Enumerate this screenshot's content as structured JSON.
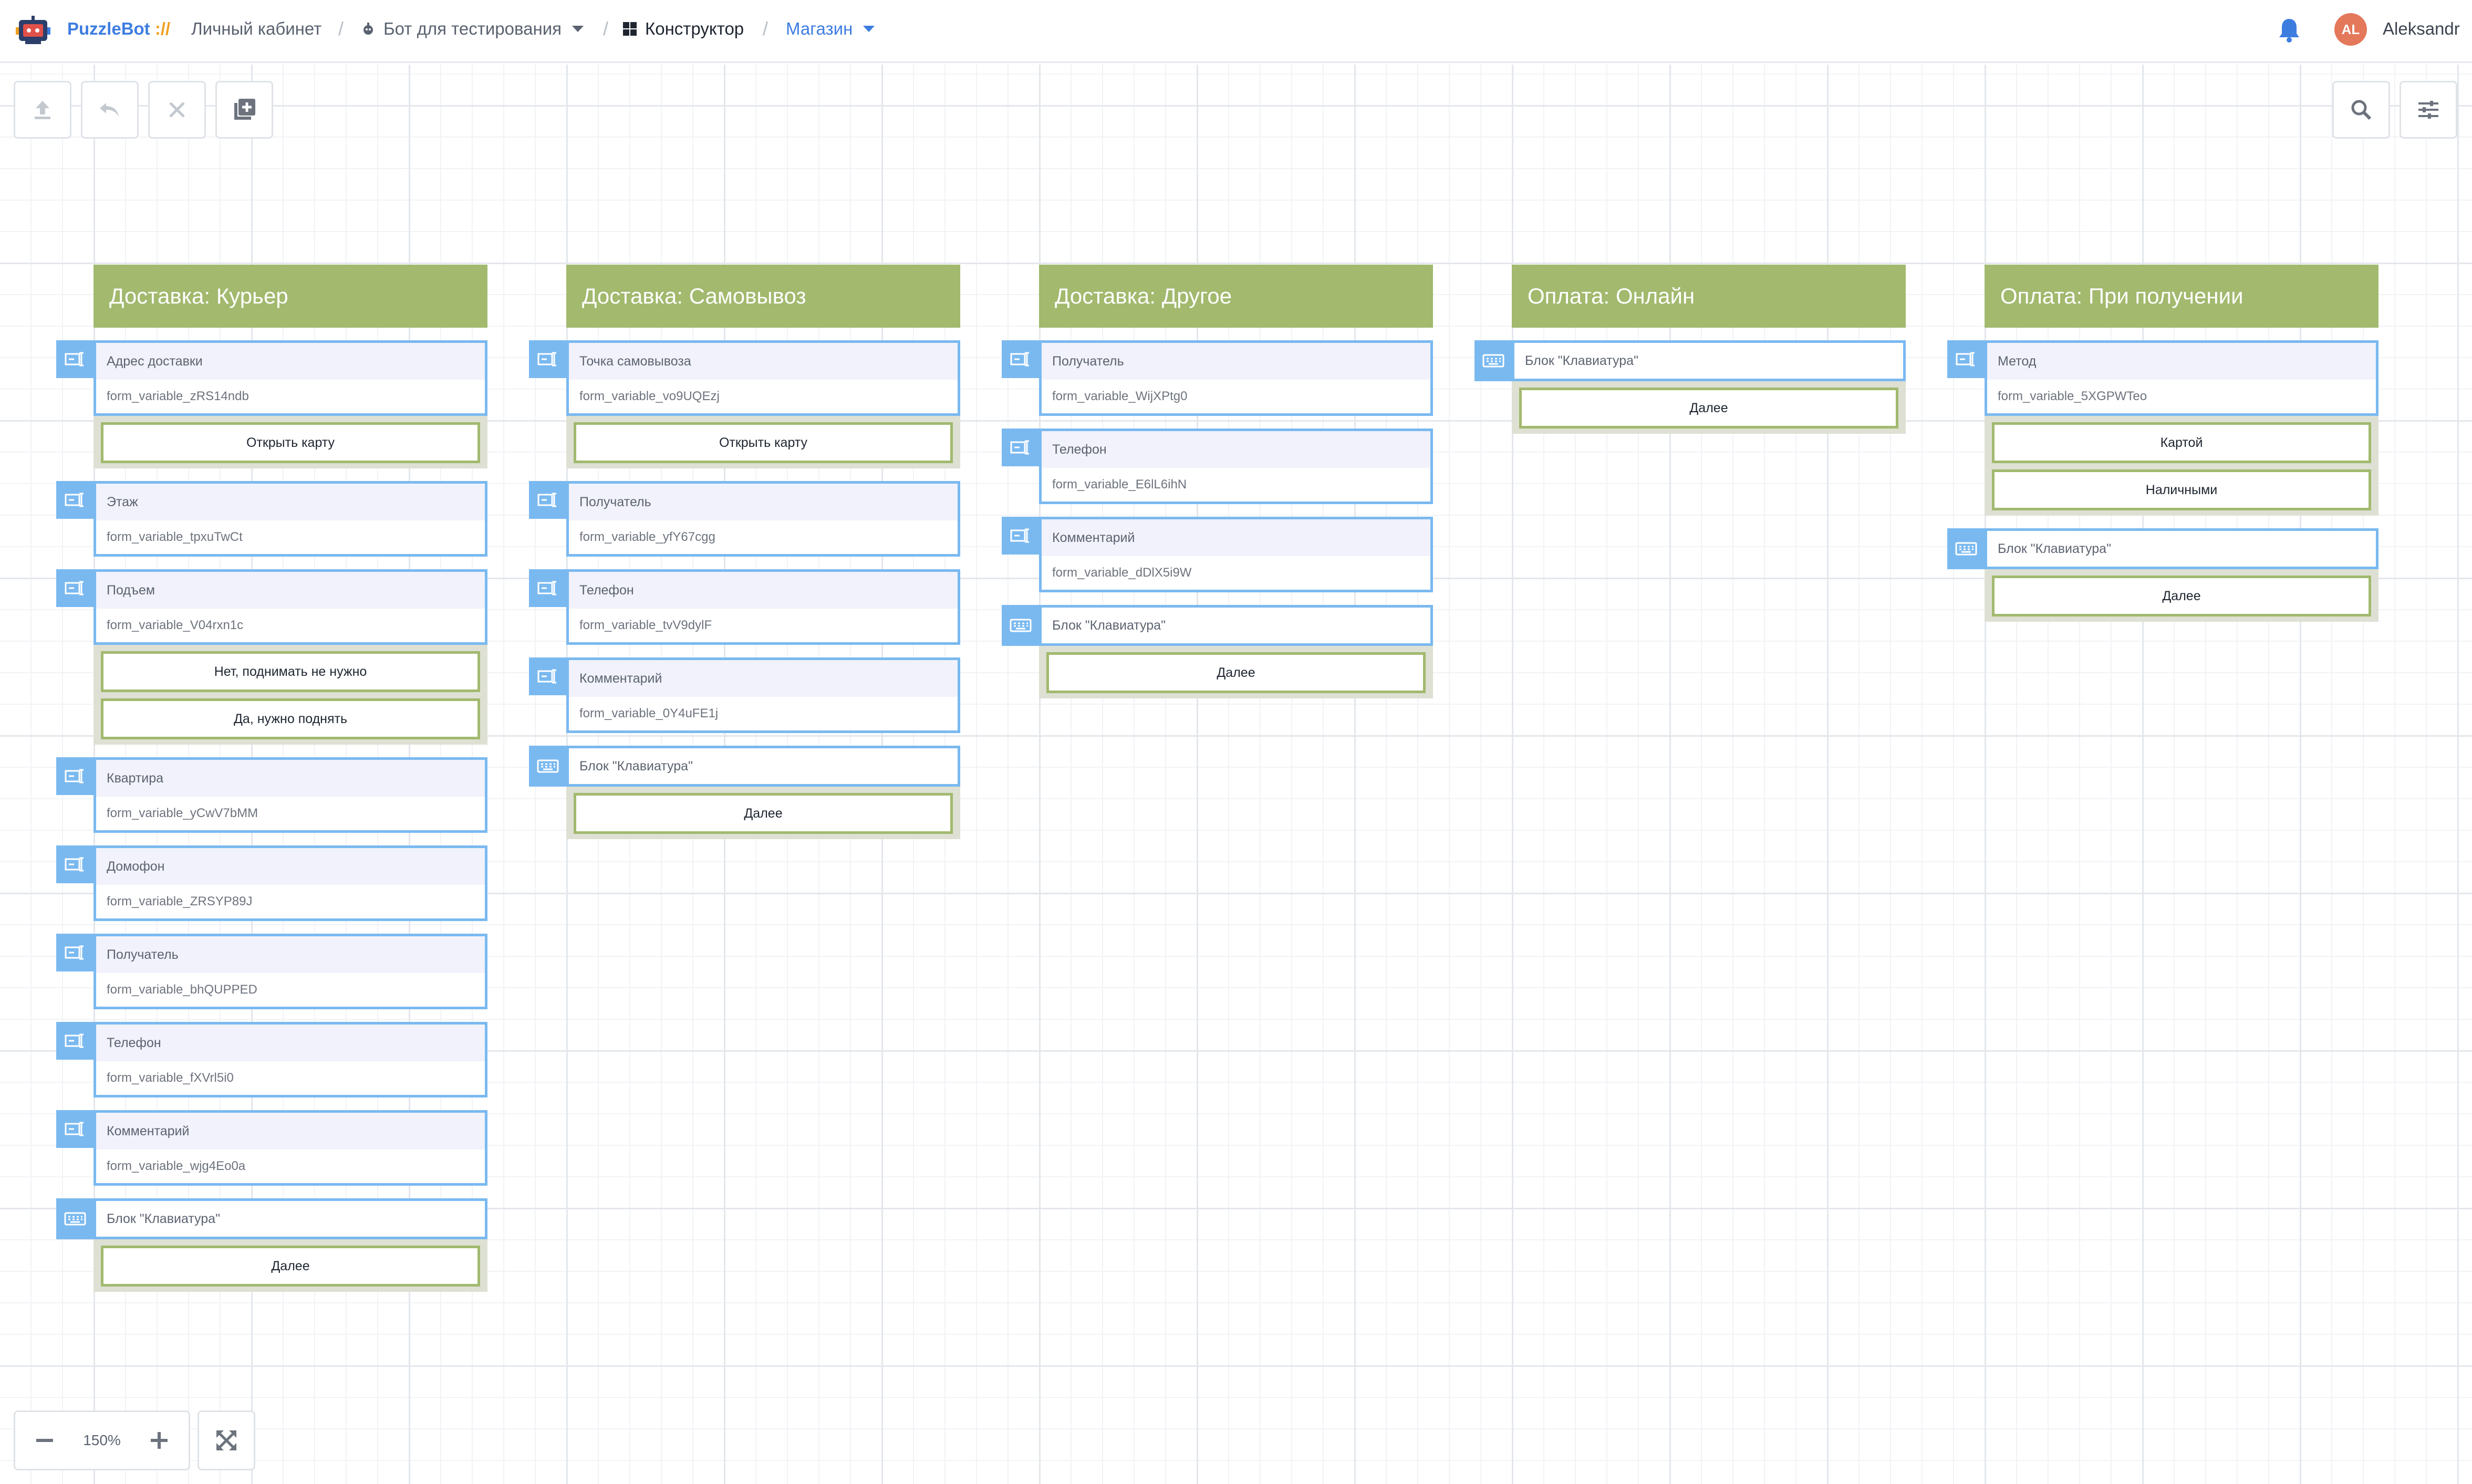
{
  "navbar": {
    "brand": "PuzzleBot",
    "brand_sep": "://",
    "breadcrumbs": [
      {
        "label": "Личный кабинет"
      },
      {
        "label": "Бот для тестирования"
      },
      {
        "label": "Конструктор"
      },
      {
        "label": "Магазин"
      }
    ],
    "user": {
      "initials": "AL",
      "name": "Aleksandr"
    }
  },
  "toolbar": {
    "left": [
      "upload-icon",
      "undo-icon",
      "close-icon",
      "add-block-icon"
    ],
    "right": [
      "search-icon",
      "settings-sliders-icon"
    ]
  },
  "colors": {
    "header_green": "#a2b96e",
    "block_blue": "#7ab9f0",
    "brand_blue": "#3d7de0",
    "avatar": "#e4785a"
  },
  "columns": [
    {
      "title": "Доставка: Курьер",
      "blocks": [
        {
          "type": "field",
          "label": "Адрес доставки",
          "variable": "form_variable_zRS14ndb",
          "buttons": [
            "Открыть карту"
          ]
        },
        {
          "type": "field",
          "label": "Этаж",
          "variable": "form_variable_tpxuTwCt",
          "buttons": []
        },
        {
          "type": "field",
          "label": "Подъем",
          "variable": "form_variable_V04rxn1c",
          "buttons": [
            "Нет, поднимать не нужно",
            "Да, нужно поднять"
          ]
        },
        {
          "type": "field",
          "label": "Квартира",
          "variable": "form_variable_yCwV7bMM",
          "buttons": []
        },
        {
          "type": "field",
          "label": "Домофон",
          "variable": "form_variable_ZRSYP89J",
          "buttons": []
        },
        {
          "type": "field",
          "label": "Получатель",
          "variable": "form_variable_bhQUPPED",
          "buttons": []
        },
        {
          "type": "field",
          "label": "Телефон",
          "variable": "form_variable_fXVrl5i0",
          "buttons": []
        },
        {
          "type": "field",
          "label": "Комментарий",
          "variable": "form_variable_wjg4Eo0a",
          "buttons": []
        },
        {
          "type": "keyboard",
          "label": "Блок \"Клавиатура\"",
          "buttons": [
            "Далее"
          ]
        }
      ]
    },
    {
      "title": "Доставка: Самовывоз",
      "blocks": [
        {
          "type": "field",
          "label": "Точка самовывоза",
          "variable": "form_variable_vo9UQEzj",
          "buttons": [
            "Открыть карту"
          ]
        },
        {
          "type": "field",
          "label": "Получатель",
          "variable": "form_variable_yfY67cgg",
          "buttons": []
        },
        {
          "type": "field",
          "label": "Телефон",
          "variable": "form_variable_tvV9dylF",
          "buttons": []
        },
        {
          "type": "field",
          "label": "Комментарий",
          "variable": "form_variable_0Y4uFE1j",
          "buttons": []
        },
        {
          "type": "keyboard",
          "label": "Блок \"Клавиатура\"",
          "buttons": [
            "Далее"
          ]
        }
      ]
    },
    {
      "title": "Доставка: Другое",
      "blocks": [
        {
          "type": "field",
          "label": "Получатель",
          "variable": "form_variable_WijXPtg0",
          "buttons": []
        },
        {
          "type": "field",
          "label": "Телефон",
          "variable": "form_variable_E6lL6ihN",
          "buttons": []
        },
        {
          "type": "field",
          "label": "Комментарий",
          "variable": "form_variable_dDlX5i9W",
          "buttons": []
        },
        {
          "type": "keyboard",
          "label": "Блок \"Клавиатура\"",
          "buttons": [
            "Далее"
          ]
        }
      ]
    },
    {
      "title": "Оплата: Онлайн",
      "blocks": [
        {
          "type": "keyboard",
          "label": "Блок \"Клавиатура\"",
          "buttons": [
            "Далее"
          ]
        }
      ]
    },
    {
      "title": "Оплата: При получении",
      "blocks": [
        {
          "type": "field",
          "label": "Метод",
          "variable": "form_variable_5XGPWTeo",
          "buttons": [
            "Картой",
            "Наличными"
          ]
        },
        {
          "type": "keyboard",
          "label": "Блок \"Клавиатура\"",
          "buttons": [
            "Далее"
          ]
        }
      ]
    }
  ],
  "zoom": {
    "level": "150%"
  }
}
